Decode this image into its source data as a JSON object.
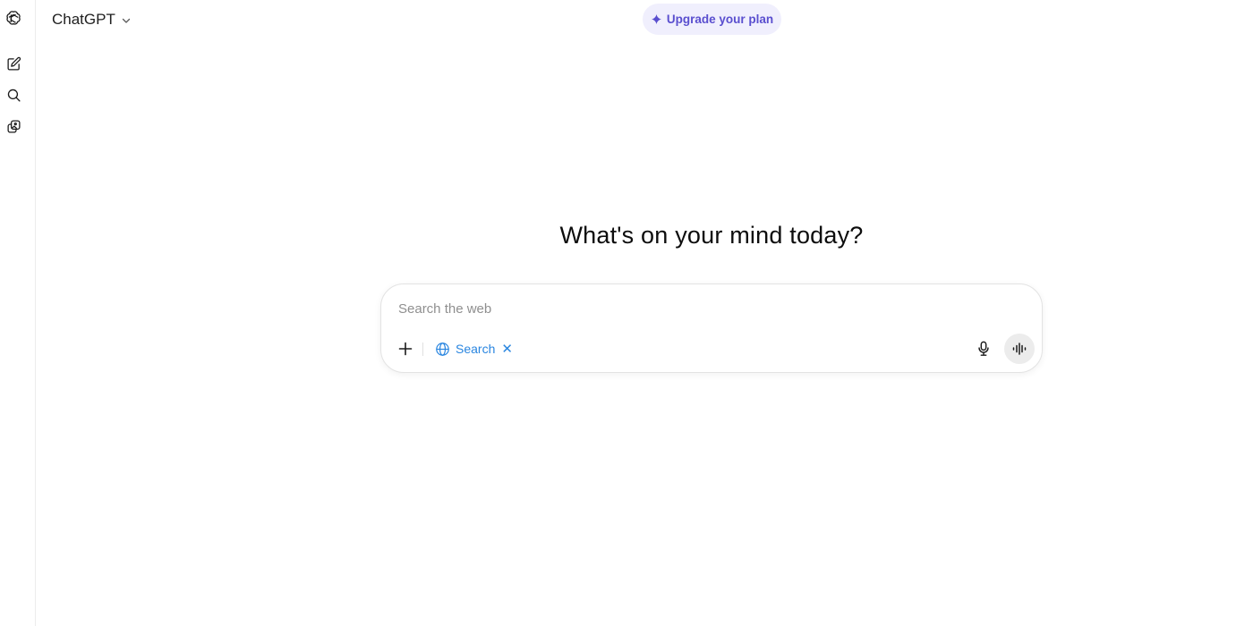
{
  "header": {
    "model_name": "ChatGPT",
    "upgrade_label": "Upgrade your plan"
  },
  "sidebar": {
    "icons": [
      "openai-logo-icon",
      "new-chat-icon",
      "search-chats-icon",
      "library-icon"
    ]
  },
  "main": {
    "headline": "What's on your mind today?"
  },
  "composer": {
    "placeholder": "Search the web",
    "search_chip_label": "Search",
    "search_chip_close": "✕"
  },
  "colors": {
    "accent": "#5a4fcf",
    "upgrade_bg": "#f0effd",
    "search_chip": "#2a86e0"
  }
}
